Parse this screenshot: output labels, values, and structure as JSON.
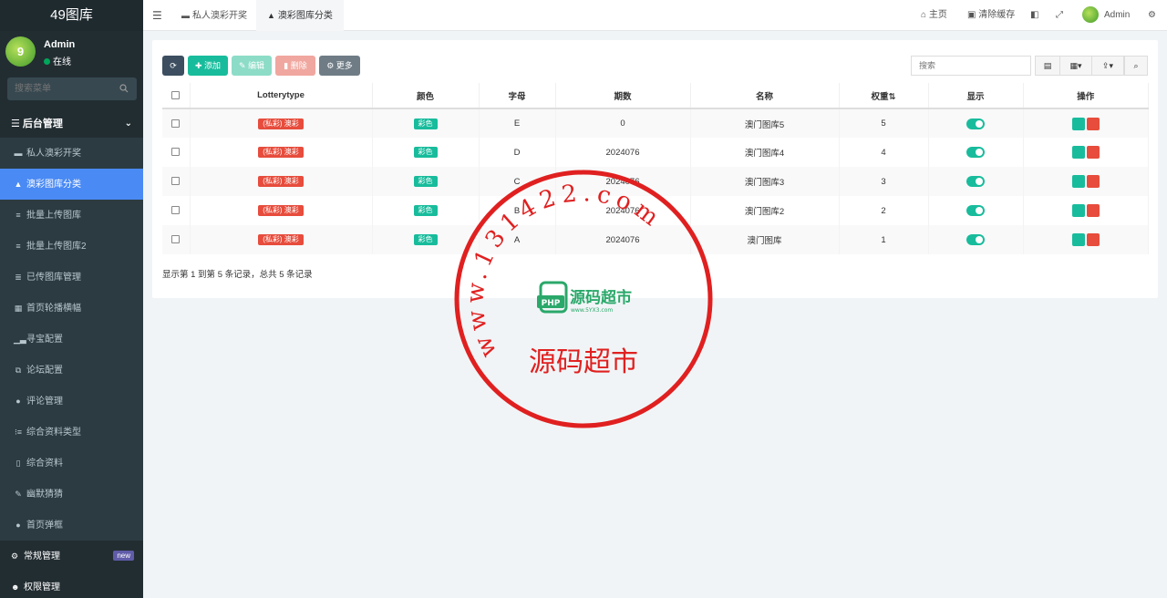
{
  "app": {
    "title": "49图库"
  },
  "user": {
    "name": "Admin",
    "status": "在线"
  },
  "sidebar": {
    "search_placeholder": "搜索菜单",
    "header": "后台管理",
    "items": [
      {
        "label": "私人澳彩开奖",
        "icon": "briefcase-icon"
      },
      {
        "label": "澳彩图库分类",
        "icon": "bell-icon",
        "active": true
      },
      {
        "label": "批量上传图库",
        "icon": "database-icon"
      },
      {
        "label": "批量上传图库2",
        "icon": "database-icon"
      },
      {
        "label": "已传图库管理",
        "icon": "list-icon"
      },
      {
        "label": "首页轮播横幅",
        "icon": "windows-icon"
      },
      {
        "label": "寻宝配置",
        "icon": "signal-icon"
      },
      {
        "label": "论坛配置",
        "icon": "clone-icon"
      },
      {
        "label": "评论管理",
        "icon": "comments-icon"
      },
      {
        "label": "综合资料类型",
        "icon": "list-ul-icon"
      },
      {
        "label": "综合资料",
        "icon": "file-icon"
      },
      {
        "label": "幽默猜猜",
        "icon": "handwriting-icon"
      },
      {
        "label": "首页弹框",
        "icon": "comment-icon"
      }
    ],
    "groups": [
      {
        "label": "常规管理",
        "badge": "new",
        "icon": "cogs-icon"
      },
      {
        "label": "权限管理",
        "icon": "users-icon"
      }
    ]
  },
  "topbar": {
    "tabs": [
      {
        "label": "私人澳彩开奖",
        "icon": "briefcase-icon"
      },
      {
        "label": "澳彩图库分类",
        "icon": "bell-icon",
        "active": true
      }
    ],
    "home": "主页",
    "clear_cache": "清除缓存",
    "admin": "Admin"
  },
  "toolbar": {
    "add": "添加",
    "edit": "编辑",
    "delete": "删除",
    "more": "更多",
    "search_placeholder": "搜索"
  },
  "table": {
    "headers": [
      "Lotterytype",
      "颜色",
      "字母",
      "期数",
      "名称",
      "权重",
      "显示",
      "操作"
    ],
    "rows": [
      {
        "lotterytype": "(私彩) 澳彩",
        "color": "彩色",
        "letter": "E",
        "issue": "0",
        "name": "澳门图库5",
        "weight": "5"
      },
      {
        "lotterytype": "(私彩) 澳彩",
        "color": "彩色",
        "letter": "D",
        "issue": "2024076",
        "name": "澳门图库4",
        "weight": "4"
      },
      {
        "lotterytype": "(私彩) 澳彩",
        "color": "彩色",
        "letter": "C",
        "issue": "2024076",
        "name": "澳门图库3",
        "weight": "3"
      },
      {
        "lotterytype": "(私彩) 澳彩",
        "color": "彩色",
        "letter": "B",
        "issue": "2024076",
        "name": "澳门图库2",
        "weight": "2"
      },
      {
        "lotterytype": "(私彩) 澳彩",
        "color": "彩色",
        "letter": "A",
        "issue": "2024076",
        "name": "澳门图库",
        "weight": "1"
      }
    ],
    "footer": "显示第 1 到第 5 条记录，总共 5 条记录"
  },
  "watermark": {
    "ring_text": "www.131422.com",
    "bottom_text": "源码超市",
    "logo_text": "源码超市",
    "logo_sub": "www.5YX3.com",
    "logo_badge": "PHP"
  },
  "colors": {
    "sidebar_bg": "#222d32",
    "active": "#4a8af4",
    "primary": "#18bc9c",
    "danger": "#e74c3c",
    "stamp": "#e02020"
  }
}
